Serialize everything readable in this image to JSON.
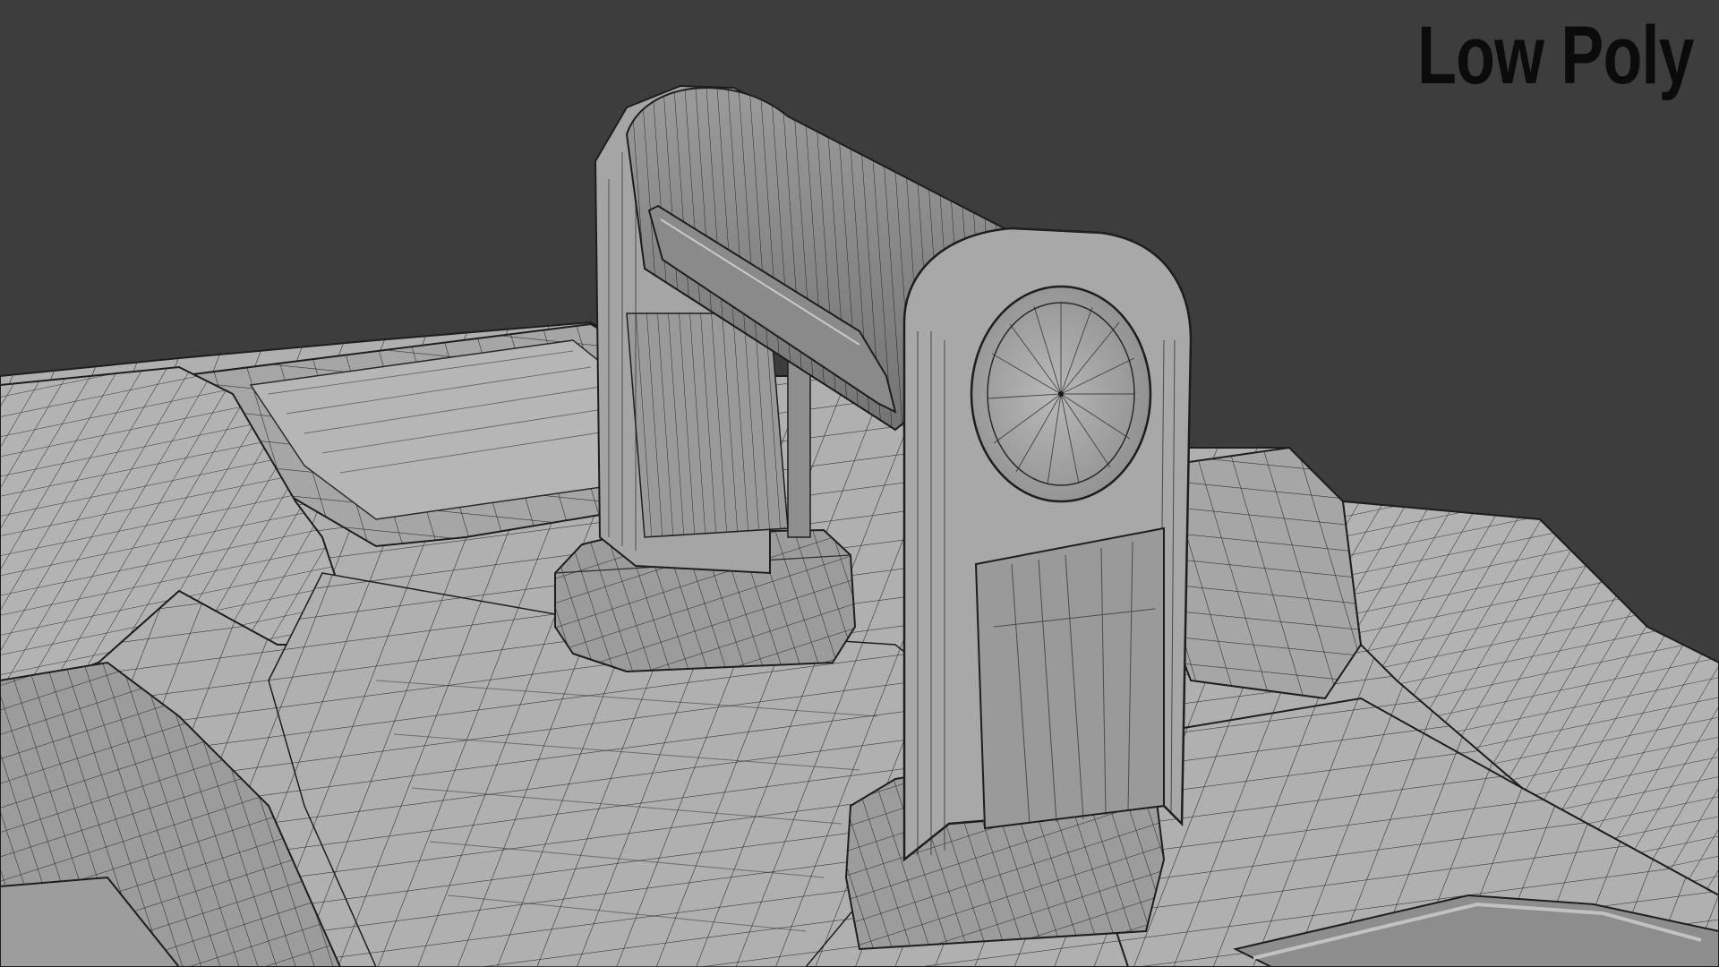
{
  "viewport": {
    "overlay_label": "Low Poly",
    "background_color": "#3d3d3d",
    "mesh_fill_color": "#a9a9a9",
    "mesh_shadow_color": "#7c7c7c",
    "mesh_highlight_color": "#c4c4c4",
    "wire_color": "#2a2a2a"
  }
}
